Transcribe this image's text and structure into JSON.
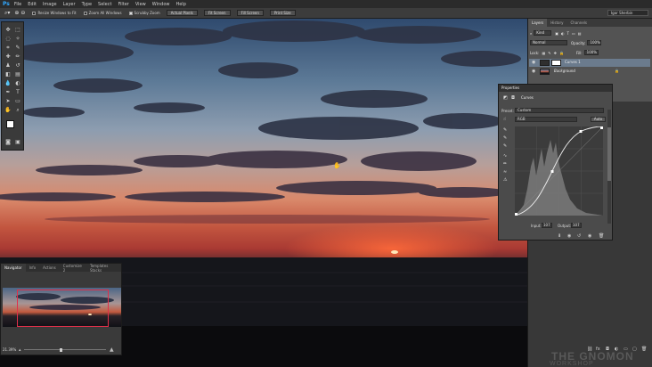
{
  "app": {
    "logo": "Ps"
  },
  "menu": [
    "File",
    "Edit",
    "Image",
    "Layer",
    "Type",
    "Select",
    "Filter",
    "View",
    "Window",
    "Help"
  ],
  "options_bar": {
    "resize_windows": "Resize Windows to Fit",
    "zoom_all": "Zoom All Windows",
    "scrubby_zoom": "Scrubby Zoom",
    "actual_pixels": "Actual Pixels",
    "fit_screen": "Fit Screen",
    "fill_screen": "Fill Screen",
    "print_size": "Print Size",
    "workspace": "Igor Sherbin"
  },
  "layers_panel": {
    "tabs": [
      "Layers",
      "History",
      "Channels"
    ],
    "kind": "Kind",
    "blend_mode": "Normal",
    "opacity_label": "Opacity:",
    "opacity": "100%",
    "lock_label": "Lock:",
    "fill_label": "Fill:",
    "fill": "100%",
    "layers": [
      {
        "name": "Curves 1",
        "selected": true
      },
      {
        "name": "Background",
        "selected": false
      }
    ]
  },
  "properties_panel": {
    "title": "Properties",
    "header": "Curves",
    "preset_label": "Preset:",
    "preset_value": "Custom",
    "channel_value": "RGB",
    "auto_label": "Auto",
    "input_label": "Input:",
    "input_value": "107",
    "output_label": "Output:",
    "output_value": "107"
  },
  "navigator": {
    "tabs": [
      "Navigator",
      "Info",
      "Actions",
      "Customize 2",
      "Templates Stacks"
    ],
    "zoom": "21.39%"
  },
  "watermark": {
    "line1": "THE GNOMON",
    "line2": "WORKSHOP"
  },
  "colors": {
    "accent_selection": "#6b7b8d",
    "navigator_box": "#e0304a",
    "photoshop_blue": "#31a8ff"
  }
}
